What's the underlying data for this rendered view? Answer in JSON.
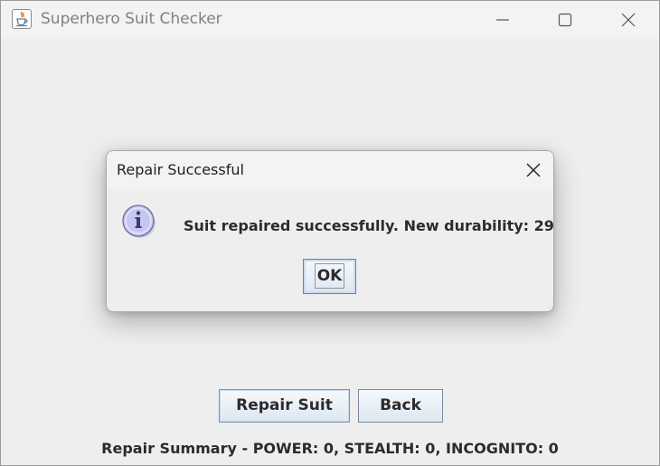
{
  "window": {
    "title": "Superhero Suit Checker",
    "icon": "java-cup-icon",
    "controls": [
      "minimize-icon",
      "maximize-icon",
      "close-icon"
    ]
  },
  "main": {
    "repair_button_label": "Repair Suit",
    "back_button_label": "Back",
    "summary_text": "Repair Summary - POWER: 0, STEALTH: 0, INCOGNITO: 0"
  },
  "dialog": {
    "title": "Repair Successful",
    "icon": "info-icon",
    "message": "Suit repaired successfully. New durability: 29",
    "ok_label": "OK"
  },
  "colors": {
    "window_background": "#eeeeee",
    "titlebar_background": "#f3f3f3",
    "button_gradient_top": "#f5f9fc",
    "button_gradient_bottom": "#dde7f1",
    "info_icon_fill": "#c6c6f0"
  }
}
